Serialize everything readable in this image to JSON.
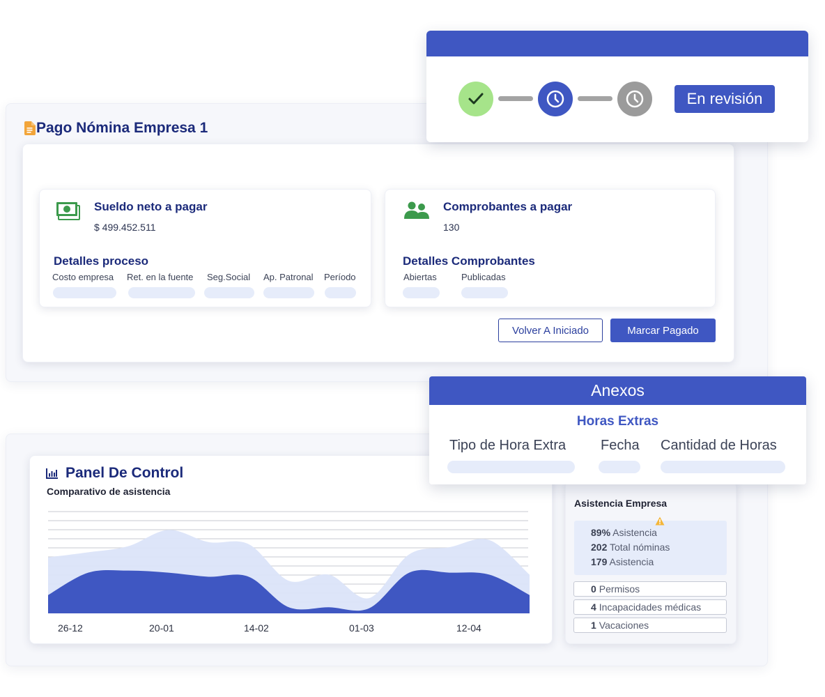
{
  "colors": {
    "primary": "#3f57c2",
    "navy": "#1b2a7a",
    "success": "#a6e48a",
    "pending": "#9b9b9b",
    "light_fill": "#dae3f8",
    "dark_fill": "#3f57c2",
    "warning": "#f4b63a"
  },
  "status": {
    "steps": [
      {
        "icon": "check-icon",
        "state": "completed"
      },
      {
        "icon": "clock-icon",
        "state": "current"
      },
      {
        "icon": "clock-icon",
        "state": "pending"
      }
    ],
    "badge": "En revisión"
  },
  "payroll": {
    "title": "Pago Nómina Empresa 1",
    "salary": {
      "title": "Sueldo neto a pagar",
      "value": "$ 499.452.511",
      "section": "Detalles proceso",
      "columns": [
        "Costo empresa",
        "Ret. en la fuente",
        "Seg.Social",
        "Ap. Patronal",
        "Período"
      ]
    },
    "vouchers": {
      "title": "Comprobantes a pagar",
      "value": "130",
      "section": "Detalles Comprobantes",
      "columns": [
        "Abiertas",
        "Publicadas"
      ]
    },
    "buttons": {
      "back": "Volver A Iniciado",
      "paid": "Marcar Pagado"
    }
  },
  "annexes": {
    "title": "Anexos",
    "subtitle": "Horas Extras",
    "columns": [
      "Tipo de Hora Extra",
      "Fecha",
      "Cantidad de Horas"
    ]
  },
  "dashboard": {
    "title": "Panel De Control",
    "chart_subtitle": "Comparativo de asistencia",
    "attendance": {
      "title": "Asistencia Empresa",
      "stats": [
        {
          "value": "89%",
          "label": "Asistencia"
        },
        {
          "value": "202",
          "label": "Total nóminas"
        },
        {
          "value": "179",
          "label": "Asistencia"
        }
      ],
      "rows": [
        {
          "value": "0",
          "label": "Permisos"
        },
        {
          "value": "4",
          "label": "Incapacidades médicas"
        },
        {
          "value": "1",
          "label": "Vacaciones"
        }
      ]
    }
  },
  "chart_data": {
    "type": "area",
    "title": "Comparativo de asistencia",
    "x_ticks": [
      "26-12",
      "20-01",
      "14-02",
      "01-03",
      "12-04"
    ],
    "series": [
      {
        "values": [
          0.55,
          0.6,
          0.66,
          0.82,
          0.7,
          0.68,
          0.32,
          0.38,
          0.15,
          0.58,
          0.65,
          0.72,
          0.38
        ]
      },
      {
        "values": [
          0.18,
          0.4,
          0.42,
          0.4,
          0.36,
          0.36,
          0.06,
          0.06,
          0.05,
          0.4,
          0.4,
          0.38,
          0.18
        ]
      }
    ],
    "gridlines": true
  }
}
